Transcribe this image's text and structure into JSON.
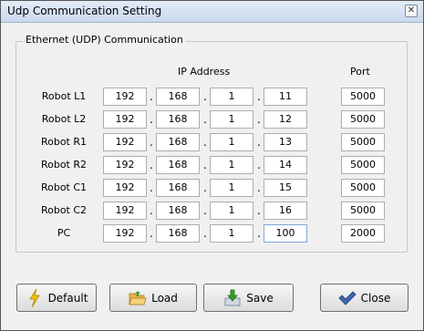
{
  "window": {
    "title": "Udp Communication Setting",
    "close_glyph": "✕"
  },
  "group": {
    "title": "Ethernet (UDP) Communication"
  },
  "headers": {
    "ip": "IP Address",
    "port": "Port"
  },
  "rows": [
    {
      "label": "Robot L1",
      "ip": [
        "192",
        "168",
        "1",
        "11"
      ],
      "port": "5000"
    },
    {
      "label": "Robot L2",
      "ip": [
        "192",
        "168",
        "1",
        "12"
      ],
      "port": "5000"
    },
    {
      "label": "Robot R1",
      "ip": [
        "192",
        "168",
        "1",
        "13"
      ],
      "port": "5000"
    },
    {
      "label": "Robot R2",
      "ip": [
        "192",
        "168",
        "1",
        "14"
      ],
      "port": "5000"
    },
    {
      "label": "Robot C1",
      "ip": [
        "192",
        "168",
        "1",
        "15"
      ],
      "port": "5000"
    },
    {
      "label": "Robot C2",
      "ip": [
        "192",
        "168",
        "1",
        "16"
      ],
      "port": "5000"
    },
    {
      "label": "PC",
      "ip": [
        "192",
        "168",
        "1",
        "100"
      ],
      "port": "2000"
    }
  ],
  "separator": ".",
  "buttons": {
    "default": {
      "label": "Default",
      "icon": "lightning-icon"
    },
    "load": {
      "label": "Load",
      "icon": "folder-open-icon"
    },
    "save": {
      "label": "Save",
      "icon": "save-arrow-icon"
    },
    "close": {
      "label": "Close",
      "icon": "checkmark-icon"
    }
  },
  "colors": {
    "lightning": "#f2c200",
    "folder": "#e8b64a",
    "save": "#3a9a2a",
    "check": "#3b67b0"
  }
}
